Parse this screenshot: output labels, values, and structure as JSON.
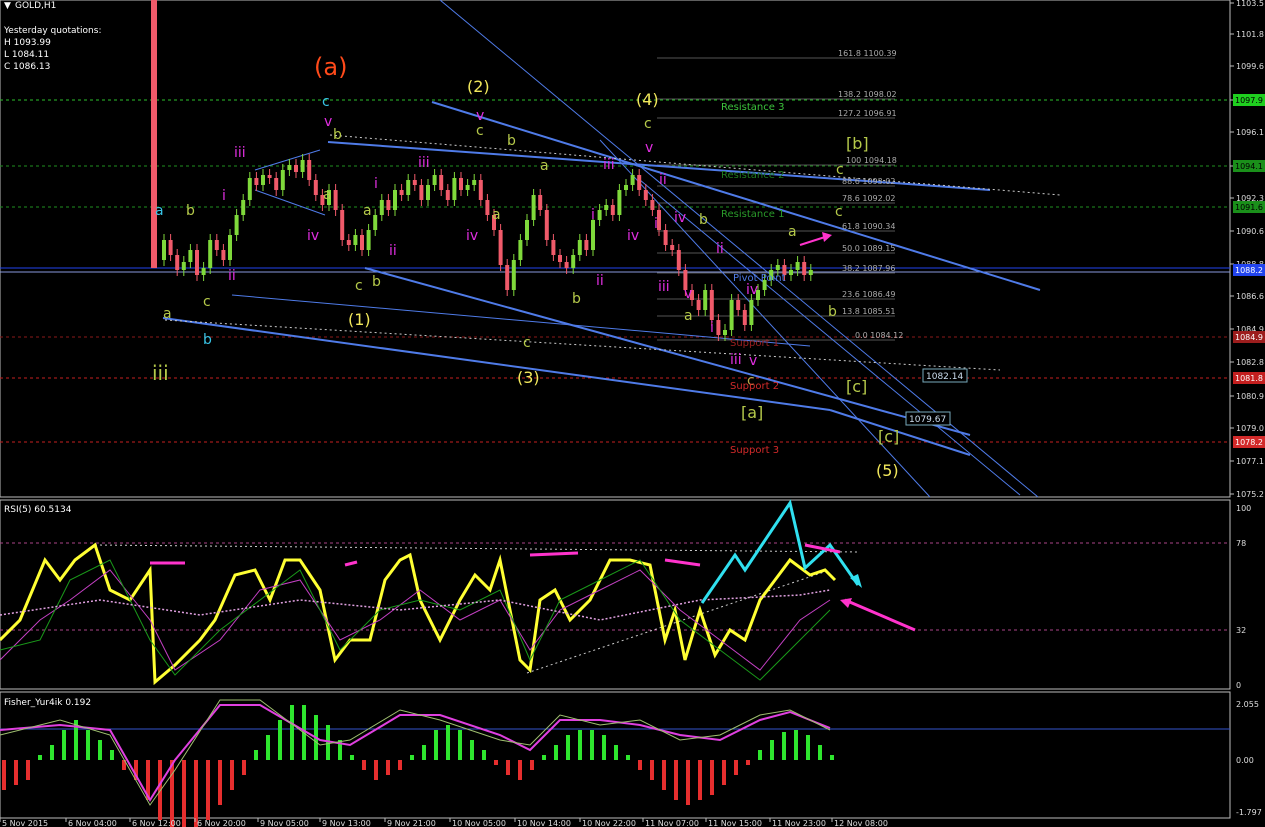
{
  "window": {
    "title": "GOLD,H1"
  },
  "quotes": {
    "heading": "Yesterday quotations:",
    "high": "H 1093.99",
    "low": "L 1084.11",
    "close": "C 1086.13"
  },
  "colors": {
    "background": "#000000",
    "bull_candle": "#7fd93b",
    "bear_candle": "#f05a6a",
    "trend_line": "#4f7be8",
    "resistance": "#3cc23c",
    "support": "#d22a2a",
    "wave_yellow": "#f2e85c",
    "wave_magenta": "#e02ee0",
    "wave_green": "#b5c94a",
    "wave_cyan": "#38c4e6",
    "rsi_line": "#ffff33",
    "arrow_cyan": "#30e0f0",
    "arrow_magenta": "#ff33cc"
  },
  "price_axis": {
    "ticks": [
      "1103.5",
      "1101.8",
      "1099.6",
      "1098.0",
      "1096.1",
      "1094.4",
      "1092.3",
      "1090.6",
      "1088.8",
      "1086.6",
      "1084.9",
      "1082.8",
      "1080.9",
      "1079.0",
      "1077.1",
      "1075.2"
    ],
    "badges": [
      {
        "text": "1097.9",
        "color": "#1fcf1f",
        "fg": "#000"
      },
      {
        "text": "1094.1",
        "color": "#1a8f1a",
        "fg": "#000"
      },
      {
        "text": "1091.6",
        "color": "#1a8f1a",
        "fg": "#000"
      },
      {
        "text": "1088.2",
        "color": "#2244ee",
        "fg": "#fff"
      },
      {
        "text": "1084.9",
        "color": "#9c1d1d",
        "fg": "#fff"
      },
      {
        "text": "1081.8",
        "color": "#c41f1f",
        "fg": "#fff"
      },
      {
        "text": "1078.2",
        "color": "#d22a2a",
        "fg": "#fff"
      }
    ]
  },
  "fib_levels": [
    "161.8 1100.39",
    "138.2 1098.02",
    "127.2 1096.91",
    "100 1094.18",
    "88.6 1093.02",
    "78.6 1092.02",
    "61.8 1090.34",
    "50.0 1089.15",
    "38.2 1087.96",
    "23.6 1086.49",
    "13.8 1085.51",
    "0.0 1084.12"
  ],
  "levels": {
    "resistance": [
      "Resistance 3",
      "Resistance 2",
      "Resistance 1"
    ],
    "pivot": "Pivot Point",
    "support": [
      "Support 1",
      "Support 2",
      "Support 3"
    ]
  },
  "price_tags": [
    "1082.14",
    "1079.67"
  ],
  "waves": {
    "primary": [
      "(a)"
    ],
    "intermediate": [
      "(1)",
      "(2)",
      "(3)",
      "(4)",
      "(5)"
    ],
    "bracket": [
      "[a]",
      "[b]",
      "[c]",
      "[c]"
    ],
    "roman_big": [
      "iii"
    ],
    "letters": [
      "a",
      "b",
      "c",
      "a",
      "b",
      "c",
      "v",
      "iv",
      "iii",
      "ii",
      "i"
    ]
  },
  "rsi": {
    "title": "RSI(5) 60.5134",
    "levels": [
      "100",
      "78",
      "32",
      "0"
    ]
  },
  "fisher": {
    "title": "Fisher_Yur4ik 0.192",
    "levels": [
      "2.055",
      "0.00",
      "-1.797"
    ]
  },
  "time_axis": [
    "5 Nov 2015",
    "6 Nov 04:00",
    "6 Nov 12:00",
    "6 Nov 20:00",
    "9 Nov 05:00",
    "9 Nov 13:00",
    "9 Nov 21:00",
    "10 Nov 05:00",
    "10 Nov 14:00",
    "10 Nov 22:00",
    "11 Nov 07:00",
    "11 Nov 15:00",
    "11 Nov 23:00",
    "12 Nov 08:00"
  ]
}
